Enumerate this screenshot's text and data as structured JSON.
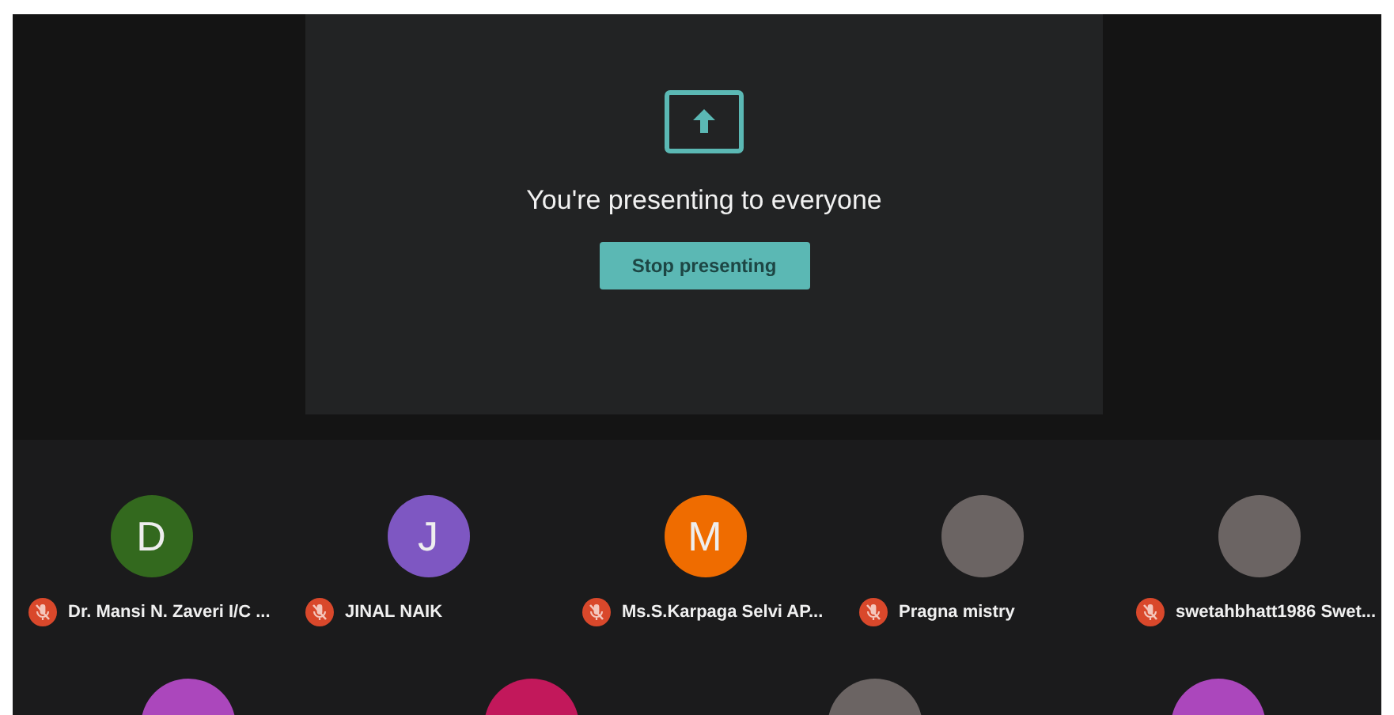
{
  "presentation": {
    "title": "You're presenting to everyone",
    "button": "Stop presenting"
  },
  "participants": [
    {
      "kind": "letter",
      "initial": "D",
      "color": "#33691e",
      "name": "Dr. Mansi N. Zaveri I/C ...",
      "muted": true
    },
    {
      "kind": "letter",
      "initial": "J",
      "color": "#7e57c2",
      "name": "JINAL NAIK",
      "muted": true
    },
    {
      "kind": "letter",
      "initial": "M",
      "color": "#ef6c00",
      "name": "Ms.S.Karpaga Selvi AP...",
      "muted": true
    },
    {
      "kind": "photo",
      "name": "Pragna mistry",
      "muted": true
    },
    {
      "kind": "photo",
      "name": "swetahbhatt1986 Swet...",
      "muted": true
    }
  ],
  "participants_row_2": [
    {
      "kind": "letter",
      "color": "#ab47bc"
    },
    {
      "kind": "letter",
      "color": "#c2185b"
    },
    {
      "kind": "photo"
    },
    {
      "kind": "letter",
      "color": "#ab47bc"
    }
  ]
}
